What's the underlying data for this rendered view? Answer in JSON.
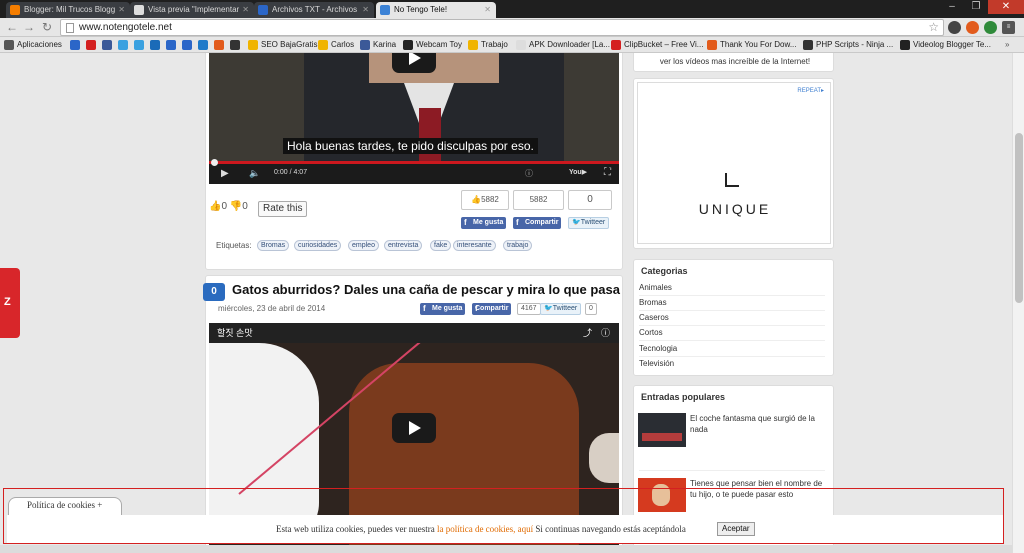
{
  "browser": {
    "tabs": [
      {
        "title": "Blogger: Mil Trucos Blogg",
        "favicon_color": "#f57d00",
        "active": false
      },
      {
        "title": "Vista previa \"Implementar",
        "favicon_color": "#dddddd",
        "active": false
      },
      {
        "title": "Archivos TXT - Archivos",
        "favicon_color": "#2b66c8",
        "active": false
      },
      {
        "title": "No Tengo Tele!",
        "favicon_color": "#3b82d6",
        "active": true
      }
    ],
    "window_controls": {
      "minimize": "–",
      "maximize": "❐",
      "close": "✕"
    },
    "url": "www.notengotele.net",
    "bookmarks": [
      {
        "label": "Aplicaciones",
        "icon": "apps-grid-icon"
      },
      {
        "label": "SEO BajaGratis",
        "icon": "folder-icon"
      },
      {
        "label": "Carlos",
        "icon": "folder-icon"
      },
      {
        "label": "Karina",
        "icon": "facebook-icon"
      },
      {
        "label": "Webcam Toy",
        "icon": "camera-icon"
      },
      {
        "label": "Trabajo",
        "icon": "folder-icon"
      },
      {
        "label": "APK Downloader [La...",
        "icon": "page-icon"
      },
      {
        "label": "ClipBucket – Free Vi...",
        "icon": "clipbucket-icon"
      },
      {
        "label": "Thank You For Dow...",
        "icon": "download-icon"
      },
      {
        "label": "PHP Scripts - Ninja ...",
        "icon": "ninja-icon"
      },
      {
        "label": "Videolog Blogger Te...",
        "icon": "videolog-icon"
      }
    ]
  },
  "post1": {
    "subtitle": "Hola buenas tardes, te pido disculpas por eso.",
    "video_time": "0:00 / 4:07",
    "likes": "0",
    "dislikes": "0",
    "rate_label": "Rate this",
    "fb_like_count": "5882",
    "fb_share_count": "5882",
    "tweet_count": "0",
    "fb_like_label": "Me gusta",
    "fb_share_label": "Compartir",
    "tweet_label": "Twitteer",
    "labels_title": "Etiquetas:",
    "tags": [
      "Bromas",
      "curiosidades",
      "empleo",
      "entrevista",
      "fake",
      "interesante",
      "trabajo"
    ]
  },
  "post2": {
    "comments": "0",
    "title": "Gatos aburridos? Dales una caña de pescar y mira lo que pasa",
    "date": "miércoles, 23 de abril de 2014",
    "fb_like_label": "Me gusta",
    "fb_share_label": "Compartir",
    "share_count": "4167",
    "tweet_label": "Twitteer",
    "tweet_count": "0",
    "video_title": "할짓 손맛"
  },
  "sidebar": {
    "top_text": "ver los vídeos mas increíble de la Internet!",
    "ad": {
      "badge": "REPEAT▸",
      "logo_text": "UNIQUE"
    },
    "categories_title": "Categorias",
    "categories": [
      "Animales",
      "Bromas",
      "Caseros",
      "Cortos",
      "Tecnologia",
      "Televisión"
    ],
    "popular_title": "Entradas populares",
    "popular": [
      {
        "title": "El coche fantasma que surgió de la nada"
      },
      {
        "title": "Tienes que pensar bien el nombre de tu hijo, o te puede pasar esto"
      }
    ]
  },
  "side_tab": {
    "label": "Z"
  },
  "cookies": {
    "tab_label": "Política de cookies +",
    "text_before": "Esta web utiliza cookies, puedes ver nuestra ",
    "link_text": "la política de cookies, aquí",
    "text_after": " Si continuas navegando estás aceptándola",
    "accept_label": "Aceptar"
  },
  "colors": {
    "accent_blue": "#2a6bbf",
    "cookie_border": "#d42020",
    "cookie_link": "#e06a00",
    "facebook": "#4866a8"
  }
}
